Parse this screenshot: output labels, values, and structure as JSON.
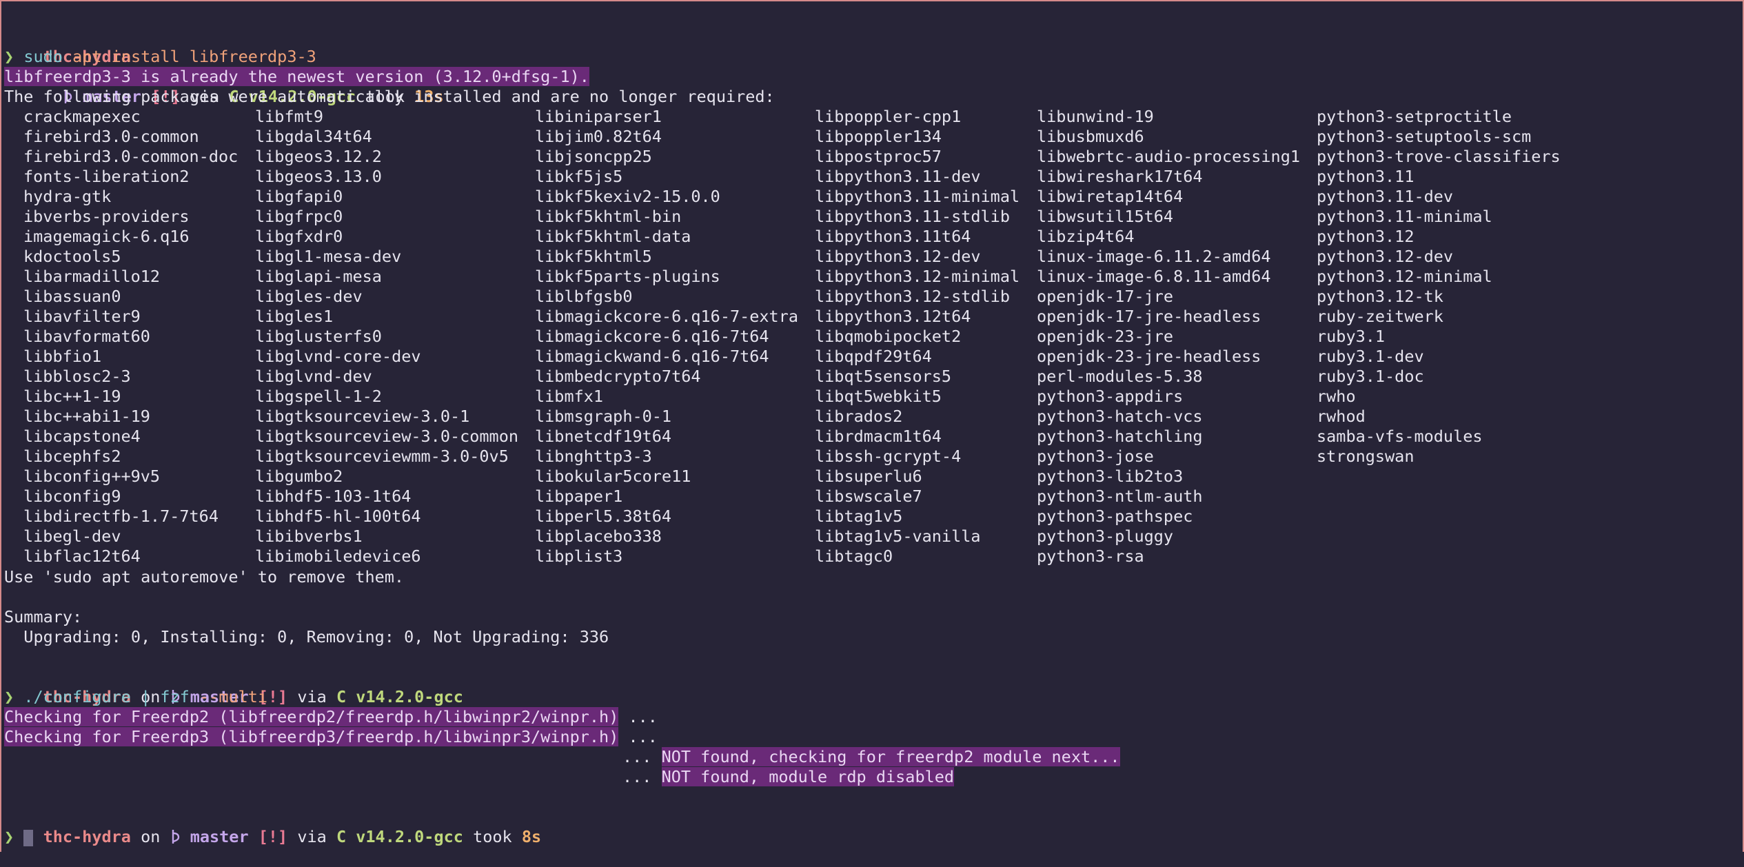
{
  "prompt1": {
    "dir": "thc-hydra",
    "on": "on",
    "branch": "master",
    "status": "[!]",
    "via": "via",
    "lang": "C v14.2.0-gcc",
    "took": "took",
    "time": "13s"
  },
  "cmd1": {
    "arrow": "❯",
    "cmd": "sudo",
    "rest": "apt install libfreerdp3-3"
  },
  "line_newest": "libfreerdp3-3 is already the newest version (3.12.0+dfsg-1).",
  "line_following": "The following packages were automatically installed and are no longer required:",
  "packages": [
    [
      "crackmapexec",
      "firebird3.0-common",
      "firebird3.0-common-doc",
      "fonts-liberation2",
      "hydra-gtk",
      "ibverbs-providers",
      "imagemagick-6.q16",
      "kdoctools5",
      "libarmadillo12",
      "libassuan0",
      "libavfilter9",
      "libavformat60",
      "libbfio1",
      "libblosc2-3",
      "libc++1-19",
      "libc++abi1-19",
      "libcapstone4",
      "libcephfs2",
      "libconfig++9v5",
      "libconfig9",
      "libdirectfb-1.7-7t64",
      "libegl-dev",
      "libflac12t64"
    ],
    [
      "libfmt9",
      "libgdal34t64",
      "libgeos3.12.2",
      "libgeos3.13.0",
      "libgfapi0",
      "libgfrpc0",
      "libgfxdr0",
      "libgl1-mesa-dev",
      "libglapi-mesa",
      "libgles-dev",
      "libgles1",
      "libglusterfs0",
      "libglvnd-core-dev",
      "libglvnd-dev",
      "libgspell-1-2",
      "libgtksourceview-3.0-1",
      "libgtksourceview-3.0-common",
      "libgtksourceviewmm-3.0-0v5",
      "libgumbo2",
      "libhdf5-103-1t64",
      "libhdf5-hl-100t64",
      "libibverbs1",
      "libimobiledevice6"
    ],
    [
      "libiniparser1",
      "libjim0.82t64",
      "libjsoncpp25",
      "libkf5js5",
      "libkf5kexiv2-15.0.0",
      "libkf5khtml-bin",
      "libkf5khtml-data",
      "libkf5khtml5",
      "libkf5parts-plugins",
      "liblbfgsb0",
      "libmagickcore-6.q16-7-extra",
      "libmagickcore-6.q16-7t64",
      "libmagickwand-6.q16-7t64",
      "libmbedcrypto7t64",
      "libmfx1",
      "libmsgraph-0-1",
      "libnetcdf19t64",
      "libnghttp3-3",
      "libokular5core11",
      "libpaper1",
      "libperl5.38t64",
      "libplacebo338",
      "libplist3"
    ],
    [
      "libpoppler-cpp1",
      "libpoppler134",
      "libpostproc57",
      "libpython3.11-dev",
      "libpython3.11-minimal",
      "libpython3.11-stdlib",
      "libpython3.11t64",
      "libpython3.12-dev",
      "libpython3.12-minimal",
      "libpython3.12-stdlib",
      "libpython3.12t64",
      "libqmobipocket2",
      "libqpdf29t64",
      "libqt5sensors5",
      "libqt5webkit5",
      "librados2",
      "librdmacm1t64",
      "libssh-gcrypt-4",
      "libsuperlu6",
      "libswscale7",
      "libtag1v5",
      "libtag1v5-vanilla",
      "libtagc0"
    ],
    [
      "libunwind-19",
      "libusbmuxd6",
      "libwebrtc-audio-processing1",
      "libwireshark17t64",
      "libwiretap14t64",
      "libwsutil15t64",
      "libzip4t64",
      "linux-image-6.11.2-amd64",
      "linux-image-6.8.11-amd64",
      "openjdk-17-jre",
      "openjdk-17-jre-headless",
      "openjdk-23-jre",
      "openjdk-23-jre-headless",
      "perl-modules-5.38",
      "python3-appdirs",
      "python3-hatch-vcs",
      "python3-hatchling",
      "python3-jose",
      "python3-lib2to3",
      "python3-ntlm-auth",
      "python3-pathspec",
      "python3-pluggy",
      "python3-rsa"
    ],
    [
      "python3-setproctitle",
      "python3-setuptools-scm",
      "python3-trove-classifiers",
      "python3.11",
      "python3.11-dev",
      "python3.11-minimal",
      "python3.12",
      "python3.12-dev",
      "python3.12-minimal",
      "python3.12-tk",
      "ruby-zeitwerk",
      "ruby3.1",
      "ruby3.1-dev",
      "ruby3.1-doc",
      "rwho",
      "rwhod",
      "samba-vfs-modules",
      "strongswan"
    ]
  ],
  "line_autoremove": "Use 'sudo apt autoremove' to remove them.",
  "summary_title": "Summary:",
  "summary_line": "  Upgrading: 0, Installing: 0, Removing: 0, Not Upgrading: 336",
  "prompt2": {
    "dir": "thc-hydra",
    "on": "on",
    "branch": "master",
    "status": "[!]",
    "via": "via",
    "lang": "C v14.2.0-gcc"
  },
  "cmd2": {
    "arrow": "❯",
    "cmd": "./configure",
    "pipe": "|",
    "cmd2": "fzf",
    "arg": "--multi"
  },
  "check1": "Checking for Freerdp2 (libfreerdp2/freerdp.h/libwinpr2/winpr.h)",
  "check1_dots": " ...",
  "check2": "Checking for Freerdp3 (libfreerdp3/freerdp.h/libwinpr3/winpr.h)",
  "check2_dots": " ...",
  "res1_dots": "... ",
  "res1": "NOT found, checking for freerdp2 module next...",
  "res2_dots": "... ",
  "res2": "NOT found, module rdp disabled",
  "prompt3": {
    "dir": "thc-hydra",
    "on": "on",
    "branch": "master",
    "status": "[!]",
    "via": "via",
    "lang": "C v14.2.0-gcc",
    "took": "took",
    "time": "8s"
  },
  "cmd3": {
    "arrow": "❯"
  },
  "colors": {
    "background": "#272437",
    "highlight": "#6a2a78",
    "dir": "#ea8a8a",
    "branch": "#c4a6ea",
    "status": "#e97a93",
    "lang": "#bfd87c",
    "time": "#f0b06c",
    "command": "#83c9d1",
    "argument": "#f0a27a",
    "border": "#d58a8a"
  }
}
